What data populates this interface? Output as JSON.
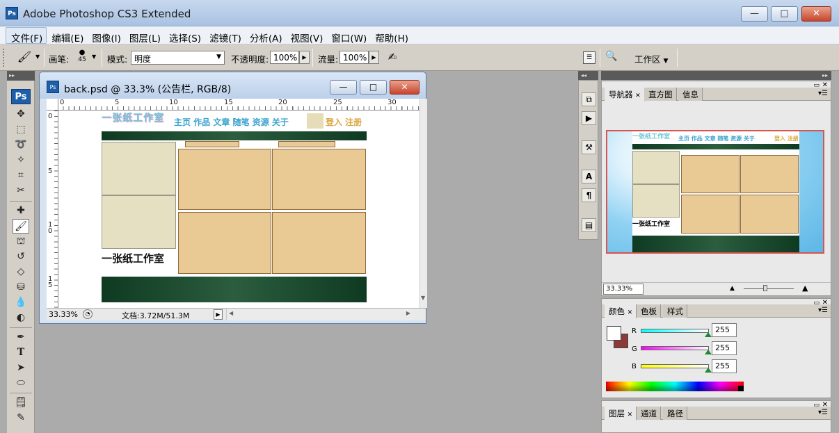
{
  "app": {
    "title": "Adobe Photoshop CS3 Extended",
    "logo": "Ps"
  },
  "window_controls": {
    "minimize": "—",
    "maximize": "□",
    "close": "✕"
  },
  "menu": [
    "文件(F)",
    "编辑(E)",
    "图像(I)",
    "图层(L)",
    "选择(S)",
    "滤镜(T)",
    "分析(A)",
    "视图(V)",
    "窗口(W)",
    "帮助(H)"
  ],
  "options": {
    "brush_label": "画笔:",
    "brush_size": "45",
    "mode_label": "模式:",
    "mode_value": "明度",
    "opacity_label": "不透明度:",
    "opacity_value": "100%",
    "flow_label": "流量:",
    "flow_value": "100%",
    "workspace_label": "工作区"
  },
  "document": {
    "title": "back.psd @ 33.3% (公告栏, RGB/8)",
    "icon_text": "Ps",
    "zoom": "33.33%",
    "doc_size": "文档:3.72M/51.3M",
    "ruler_h": [
      "0",
      "5",
      "10",
      "15",
      "20",
      "25",
      "30"
    ],
    "ruler_v": [
      "0",
      "5",
      "1\n0",
      "1\n5"
    ],
    "site_logo": "一张纸工作室",
    "nav_links": "主页 作品 文章 随笔 资源 关于",
    "login": "登入 注册",
    "footer_logo": "一张纸工作室"
  },
  "navigator": {
    "tabs": [
      "导航器",
      "直方图",
      "信息"
    ],
    "zoom": "33.33%",
    "thumb_nav": "主页 作品 文章 随笔 资源 关于",
    "thumb_login": "登入 注册",
    "thumb_logo": "一张纸工作室"
  },
  "color_panel": {
    "tabs": [
      "颜色",
      "色板",
      "样式"
    ],
    "channels": [
      {
        "label": "R",
        "value": "255"
      },
      {
        "label": "G",
        "value": "255"
      },
      {
        "label": "B",
        "value": "255"
      }
    ],
    "foreground": "#ffffff",
    "background": "#8b3a3a"
  },
  "layers_panel": {
    "tabs": [
      "图层",
      "通道",
      "路径"
    ]
  },
  "icons": [
    "brush-icon",
    "move-icon",
    "marquee-icon",
    "lasso-icon",
    "magic-wand-icon",
    "crop-icon",
    "slice-icon",
    "healing-icon",
    "brush-tool-icon",
    "stamp-icon",
    "history-brush-icon",
    "eraser-icon",
    "bucket-icon",
    "blur-icon",
    "dodge-icon",
    "pen-icon",
    "type-icon",
    "path-select-icon",
    "ellipse-icon",
    "notes-icon",
    "eyedropper-icon"
  ]
}
